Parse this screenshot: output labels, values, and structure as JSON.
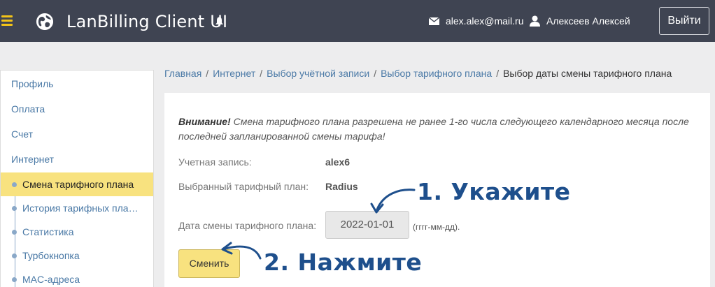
{
  "header": {
    "app_title": "LanBilling Client UI",
    "email": "alex.alex@mail.ru",
    "username": "Алексеев Алексей",
    "logout_label": "Выйти",
    "accent_color": "#f2c318",
    "background_color": "#3f4452"
  },
  "sidebar": {
    "items": [
      {
        "label": "Профиль"
      },
      {
        "label": "Оплата"
      },
      {
        "label": "Счет"
      },
      {
        "label": "Интернет"
      }
    ],
    "sub_items": [
      {
        "label": "Смена тарифного плана",
        "active": true
      },
      {
        "label": "История тарифных планов"
      },
      {
        "label": "Статистика"
      },
      {
        "label": "Турбокнопка"
      },
      {
        "label": "MAC-адреса"
      }
    ],
    "active_color": "#f8e27f"
  },
  "breadcrumb": {
    "items": [
      "Главная",
      "Интернет",
      "Выбор учётной записи",
      "Выбор тарифного плана"
    ],
    "current": "Выбор даты смены тарифного плана"
  },
  "form": {
    "warning_title": "Внимание!",
    "warning_text": "Смена тарифного плана разрешена не ранее 1-го числа следующего календарного месяца после последней запланированной смены тарифа!",
    "account_label": "Учетная запись:",
    "account_value": "alex6",
    "plan_label": "Выбранный тарифный план:",
    "plan_value": "Radius",
    "date_label": "Дата смены тарифного плана:",
    "date_value": "2022-01-01",
    "date_hint": "(гггг-мм-дд).",
    "submit_label": "Сменить"
  },
  "annotations": {
    "step1": "1. Укажите",
    "step2": "2. Нажмите",
    "color": "#1e4f8c"
  }
}
